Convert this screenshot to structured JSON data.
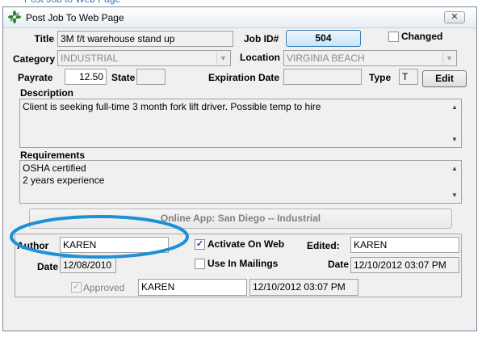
{
  "window": {
    "title": "Post Job To Web Page",
    "close_label": "✕"
  },
  "header": {
    "title_label": "Title",
    "title_value": "3M  f/t warehouse stand up",
    "job_id_label": "Job ID#",
    "job_id_value": "504",
    "changed_label": "Changed",
    "category_label": "Category",
    "category_value": "INDUSTRIAL",
    "location_label": "Location",
    "location_value": "VIRGINIA BEACH",
    "payrate_label": "Payrate",
    "payrate_value": "12.50",
    "state_label": "State",
    "state_value": "",
    "expiration_label": "Expiration Date",
    "expiration_value": "",
    "type_label": "Type",
    "type_value": "T",
    "edit_label": "Edit"
  },
  "description": {
    "label": "Description",
    "lines": [
      "Client is seeking full-time 3 month fork lift driver. Possible temp to hire"
    ]
  },
  "requirements": {
    "label": "Requirements",
    "lines": [
      "OSHA certified",
      "2 years experience"
    ]
  },
  "online_app": {
    "label": "Online App: San Diego -- Industrial"
  },
  "posting": {
    "author_label": "Author",
    "author_value": "KAREN",
    "date_label": "Date",
    "date_value": "12/08/2010",
    "activate_label": "Activate On Web",
    "activate_checked": true,
    "mailings_label": "Use In Mailings",
    "mailings_checked": false,
    "edited_label": "Edited:",
    "edited_value": "KAREN",
    "edited_date_label": "Date",
    "edited_date_value": "12/10/2012 03:07 PM",
    "approved_label": "Approved",
    "approved_checked": true,
    "approved_by": "KAREN",
    "approved_date": "12/10/2012 03:07 PM"
  },
  "colors": {
    "annotation": "#1e90d8",
    "title_accent": "#3b6fb6"
  }
}
